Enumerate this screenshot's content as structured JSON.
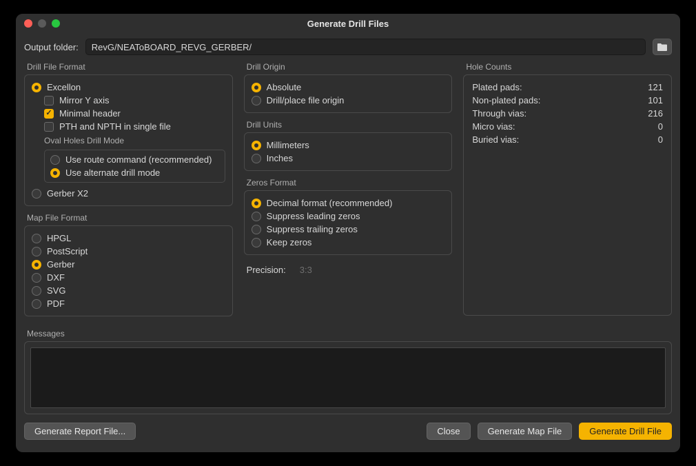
{
  "window": {
    "title": "Generate Drill Files"
  },
  "output": {
    "label": "Output folder:",
    "value": "RevG/NEAToBOARD_REVG_GERBER/"
  },
  "drillFileFormat": {
    "title": "Drill File Format",
    "excellon": "Excellon",
    "mirrorY": "Mirror Y axis",
    "minimalHeader": "Minimal header",
    "pthNpth": "PTH and NPTH in single file",
    "ovalTitle": "Oval Holes Drill Mode",
    "useRoute": "Use route command (recommended)",
    "useAlt": "Use alternate drill mode",
    "gerberX2": "Gerber X2"
  },
  "mapFileFormat": {
    "title": "Map File Format",
    "items": [
      "HPGL",
      "PostScript",
      "Gerber",
      "DXF",
      "SVG",
      "PDF"
    ],
    "selected": "Gerber"
  },
  "drillOrigin": {
    "title": "Drill Origin",
    "absolute": "Absolute",
    "placeOrigin": "Drill/place file origin"
  },
  "drillUnits": {
    "title": "Drill Units",
    "mm": "Millimeters",
    "in": "Inches"
  },
  "zerosFormat": {
    "title": "Zeros Format",
    "decimal": "Decimal format (recommended)",
    "suppressLeading": "Suppress leading zeros",
    "suppressTrailing": "Suppress trailing zeros",
    "keepZeros": "Keep zeros"
  },
  "precision": {
    "label": "Precision:",
    "value": "3:3"
  },
  "holeCounts": {
    "title": "Hole Counts",
    "rows": [
      {
        "label": "Plated pads:",
        "value": "121"
      },
      {
        "label": "Non-plated pads:",
        "value": "101"
      },
      {
        "label": "Through vias:",
        "value": "216"
      },
      {
        "label": "Micro vias:",
        "value": "0"
      },
      {
        "label": "Buried vias:",
        "value": "0"
      }
    ]
  },
  "messages": {
    "title": "Messages"
  },
  "buttons": {
    "report": "Generate Report File...",
    "close": "Close",
    "map": "Generate Map File",
    "drill": "Generate Drill File"
  }
}
